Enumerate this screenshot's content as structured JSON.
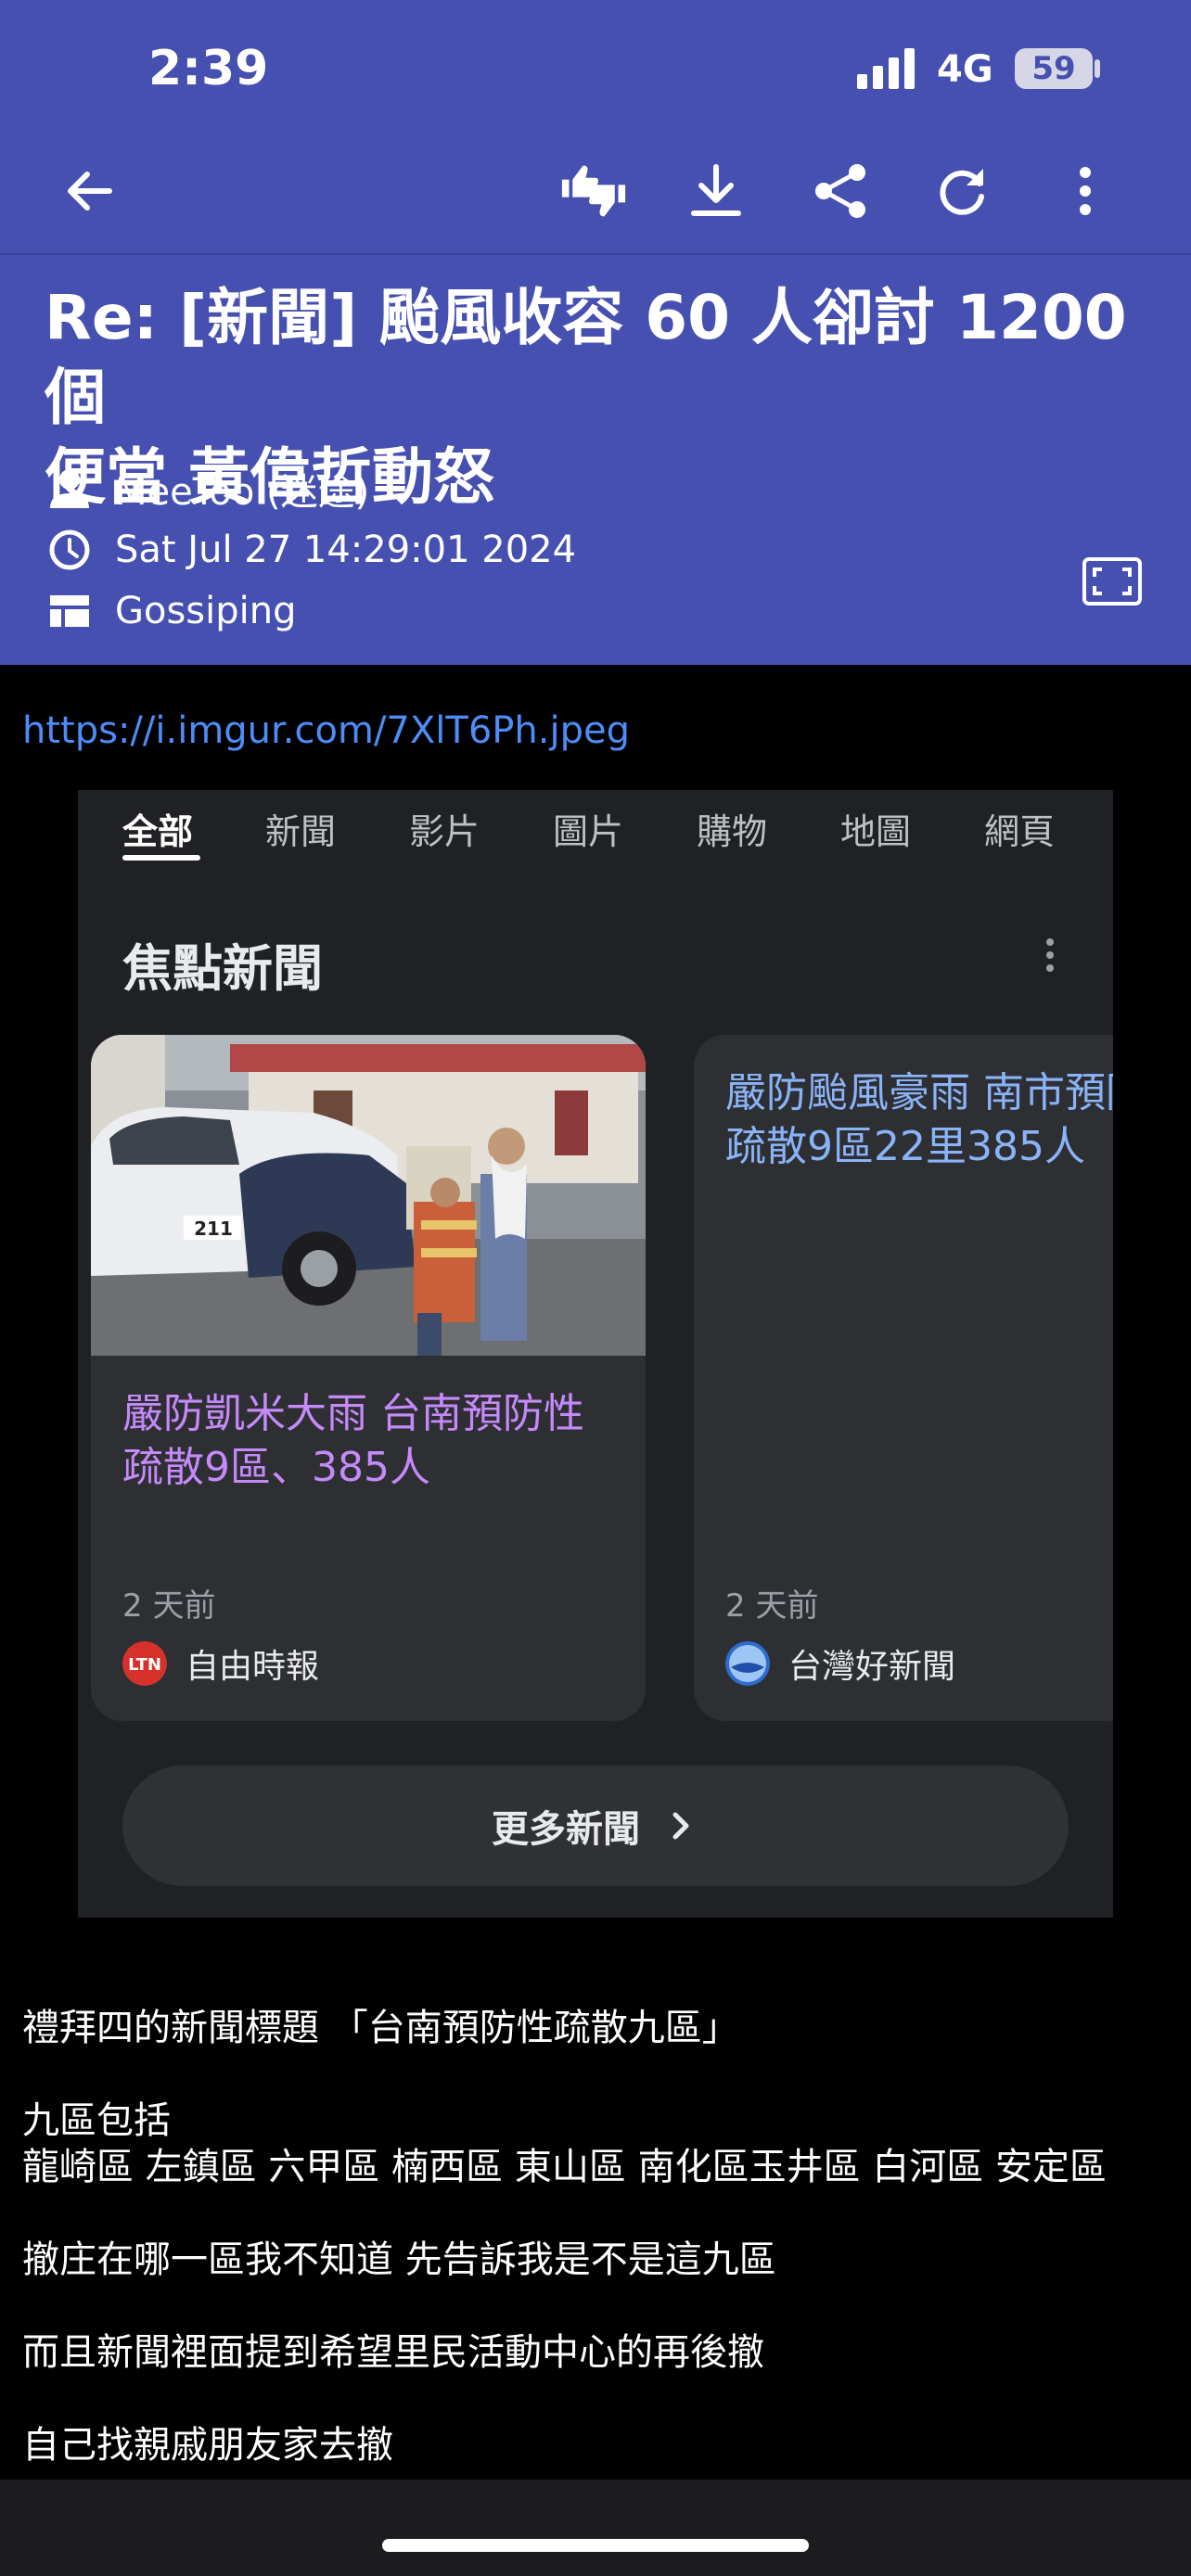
{
  "status": {
    "time": "2:39",
    "network": "4G",
    "battery": "59"
  },
  "article": {
    "title_line1": "Re: [新聞] 颱風收容 60 人卻討 1200 個",
    "title_line2": "便當 黃偉哲動怒",
    "author": "MeeToo (迷途)",
    "date": "Sat Jul 27 14:29:01 2024",
    "board": "Gossiping",
    "link": "https://i.imgur.com/7XlT6Ph.jpeg"
  },
  "embedded": {
    "tabs": [
      "全部",
      "新聞",
      "影片",
      "圖片",
      "購物",
      "地圖",
      "網頁"
    ],
    "section_title": "焦點新聞",
    "cards": [
      {
        "headline_line1": "嚴防凱米大雨 台南預防性",
        "headline_line2": "疏散9區、385人",
        "ago": "2 天前",
        "source": "自由時報",
        "logo_text": "LTN",
        "car_number": "211"
      },
      {
        "headline_line1": "嚴防颱風豪雨 南市預防性",
        "headline_line2": "疏散9區22里385人",
        "ago": "2 天前",
        "source": "台灣好新聞"
      }
    ],
    "more_label": "更多新聞"
  },
  "body": [
    "禮拜四的新聞標題 「台南預防性疏散九區」",
    "九區包括",
    "龍崎區 左鎮區 六甲區 楠西區 東山區 南化區玉井區 白河區 安定區",
    "撤庄在哪一區我不知道 先告訴我是不是這九區",
    "而且新聞裡面提到希望里民活動中心的再後撤",
    "自己找親戚朋友家去撤"
  ],
  "colors": {
    "header": "#4550b0",
    "link": "#4d8df7",
    "visited_headline": "#c58af9",
    "headline": "#8ab4f8"
  }
}
